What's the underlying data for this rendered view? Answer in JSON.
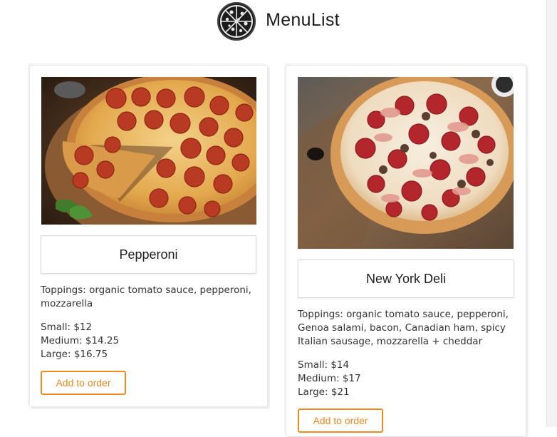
{
  "app": {
    "title": "MenuList",
    "logo_icon": "pizza-logo-icon"
  },
  "colors": {
    "accent": "#f0891f",
    "text": "#2b2b2b",
    "border": "#d9d9d9"
  },
  "menu_items": [
    {
      "name": "Pepperoni",
      "toppings": "Toppings: organic tomato sauce, pepperoni, mozzarella",
      "prices": [
        "Small: $12",
        "Medium: $14.25",
        "Large: $16.75"
      ],
      "button_label": "Add to order"
    },
    {
      "name": "New York Deli",
      "toppings": "Toppings: organic tomato sauce, pepperoni, Genoa salami, bacon, Canadian ham, spicy Italian sausage, mozzarella + cheddar",
      "prices": [
        "Small: $14",
        "Medium: $17",
        "Large: $21"
      ],
      "button_label": "Add to order"
    }
  ]
}
